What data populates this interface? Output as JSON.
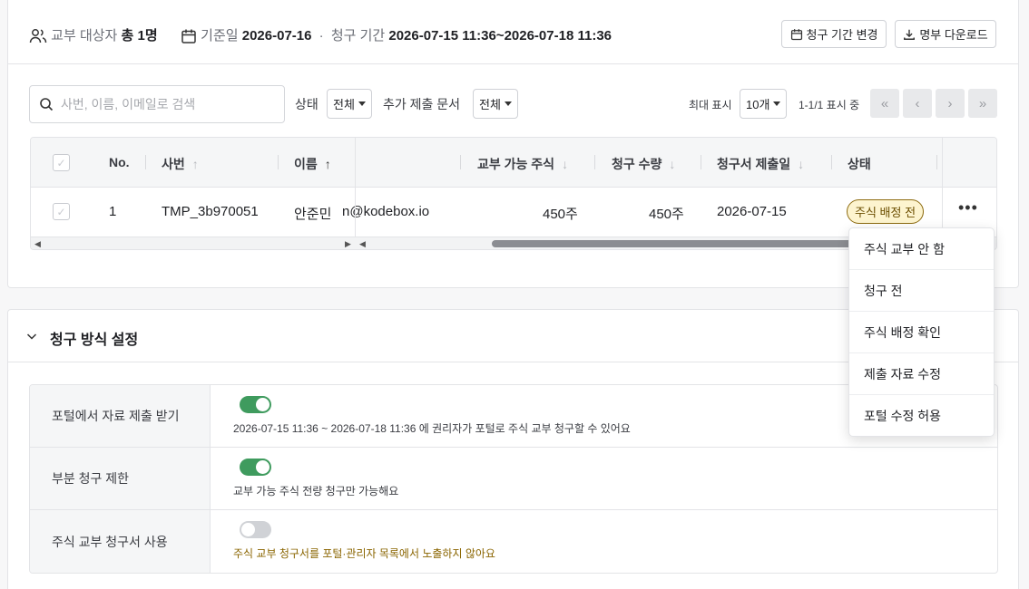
{
  "header": {
    "target_label": "교부 대상자",
    "target_count": "총 1명",
    "base_date_label": "기준일",
    "base_date": "2026-07-16",
    "dot": "·",
    "period_label": "청구 기간",
    "period": "2026-07-15 11:36~2026-07-18 11:36",
    "change_period_button": "청구 기간 변경",
    "download_button": "명부 다운로드"
  },
  "filters": {
    "search_placeholder": "사번, 이름, 이메일로 검색",
    "status_label": "상태",
    "status_value": "전체",
    "docs_label": "추가 제출 문서",
    "docs_value": "전체",
    "max_display_label": "최대 표시",
    "max_display_value": "10개",
    "range_text": "1-1/1 표시 중",
    "first_page": "«",
    "prev_page": "‹",
    "next_page": "›",
    "last_page": "»"
  },
  "table": {
    "columns": {
      "no": "No.",
      "emp_no": "사번",
      "name": "이름",
      "available": "교부 가능 주식",
      "claim_qty": "청구 수량",
      "submit_date": "청구서 제출일",
      "status": "상태"
    },
    "rows": [
      {
        "no": "1",
        "emp_no": "TMP_3b970051",
        "name": "안준민",
        "email_partial": "n@kodebox.io",
        "available": "450주",
        "claim_qty": "450주",
        "submit_date": "2026-07-15",
        "status": "주식 배정 전"
      }
    ]
  },
  "status_menu": {
    "items": [
      "주식 교부 안 함",
      "청구 전",
      "주식 배정 확인",
      "제출 자료 수정",
      "포털 수정 허용"
    ]
  },
  "claim_settings": {
    "title": "청구 방식 설정",
    "rows": [
      {
        "label": "포털에서 자료 제출 받기",
        "enabled": true,
        "description": "2026-07-15 11:36 ~ 2026-07-18 11:36 에 권리자가 포털로 주식 교부 청구할 수 있어요"
      },
      {
        "label": "부분 청구 제한",
        "enabled": true,
        "description": "교부 가능 주식 전량 청구만 가능해요"
      },
      {
        "label": "주식 교부 청구서 사용",
        "enabled": false,
        "description": "주식 교부 청구서를 포털·관리자 목록에서 노출하지 않아요"
      }
    ]
  },
  "colors": {
    "toggle_on": "#3f9b5e",
    "toggle_off": "#d0d2d6",
    "badge_bg": "#fdf4cf",
    "badge_border": "#8d6b10"
  }
}
